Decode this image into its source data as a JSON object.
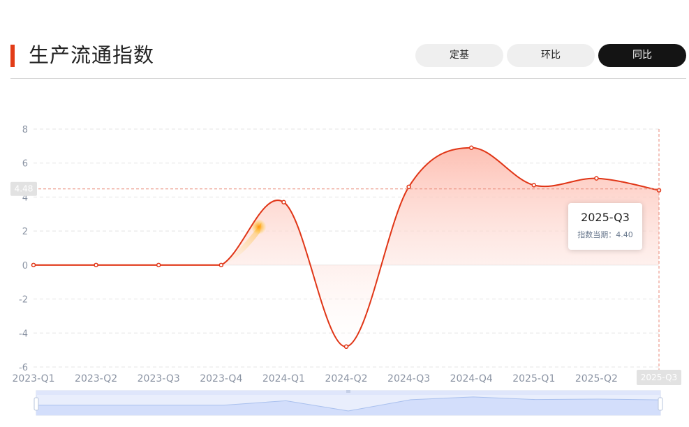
{
  "header": {
    "title": "生产流通指数",
    "tabs": [
      {
        "label": "定基",
        "active": false
      },
      {
        "label": "环比",
        "active": false
      },
      {
        "label": "同比",
        "active": true
      }
    ]
  },
  "colors": {
    "accent": "#e23c17",
    "line": "#e03516",
    "area_top": "#fdbdb0",
    "tab_active_bg": "#141414",
    "tab_bg": "#efefef",
    "axis_text": "#8a93a3"
  },
  "chart_data": {
    "type": "area",
    "categories": [
      "2023-Q1",
      "2023-Q2",
      "2023-Q3",
      "2023-Q4",
      "2024-Q1",
      "2024-Q2",
      "2024-Q3",
      "2024-Q4",
      "2025-Q1",
      "2025-Q2",
      "2025-Q3"
    ],
    "series": [
      {
        "values": [
          0,
          0,
          0,
          0,
          3.7,
          -4.8,
          4.6,
          6.9,
          4.7,
          5.1,
          4.4
        ]
      }
    ],
    "ylim": [
      -6,
      8
    ],
    "yticks": [
      8,
      6,
      4,
      2,
      0,
      -2,
      -4,
      -6
    ],
    "grid": true,
    "crosshair": {
      "category": "2025-Q3",
      "y_label": "4.48",
      "x_label": "2025-Q3"
    },
    "tooltip": {
      "title": "2025-Q3",
      "label": "指数当期：",
      "value": "4.40"
    }
  }
}
